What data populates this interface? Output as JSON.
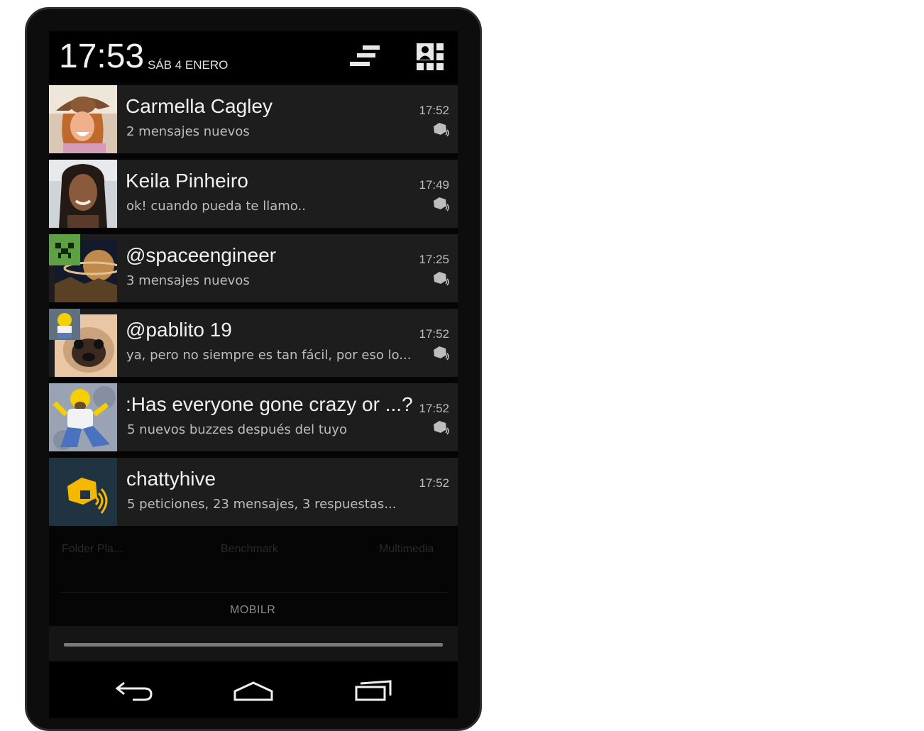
{
  "status": {
    "time": "17:53",
    "date": "SÁB 4 ENERO",
    "clear_icon": "clear-all-icon",
    "quick_settings_icon": "quick-settings-icon"
  },
  "notifications": [
    {
      "title": "Carmella Cagley",
      "text": "2 mensajes nuevos",
      "time": "17:52",
      "avatar": "contact-photo-woman-cowboy-hat",
      "app_icon": "chattyhive-icon"
    },
    {
      "title": "Keila Pinheiro",
      "text": "ok! cuando pueda te llamo..",
      "time": "17:49",
      "avatar": "contact-photo-woman",
      "app_icon": "chattyhive-icon"
    },
    {
      "title": "@spaceengineer",
      "text": "3 mensajes nuevos",
      "time": "17:25",
      "avatar": "creeper-and-planet",
      "app_icon": "chattyhive-icon"
    },
    {
      "title": "@pablito 19",
      "text": "ya, pero no siempre es tan fácil, por eso lo...",
      "time": "17:52",
      "avatar": "homer-and-pug",
      "app_icon": "chattyhive-icon"
    },
    {
      "title": ":Has everyone gone crazy or ...?",
      "text": "5 nuevos buzzes después del tuyo",
      "time": "17:52",
      "avatar": "homer-screaming",
      "app_icon": "chattyhive-icon"
    },
    {
      "title": "chattyhive",
      "text": "5 peticiones, 23 mensajes, 3 respuestas...",
      "time": "17:52",
      "avatar": "chattyhive-logo",
      "app_icon": ""
    }
  ],
  "background": {
    "folder_label": "Folder Pla...",
    "benchmark_label": "Benchmark",
    "multimedia_label": "Multimedia",
    "dock_label": "MOBILR"
  },
  "navbar": {
    "back_icon": "back-icon",
    "home_icon": "home-icon",
    "recents_icon": "recents-icon"
  },
  "colors": {
    "accent": "#f5b800",
    "notif_bg": "#1d1d1d",
    "logo_bg": "#1f3340"
  }
}
